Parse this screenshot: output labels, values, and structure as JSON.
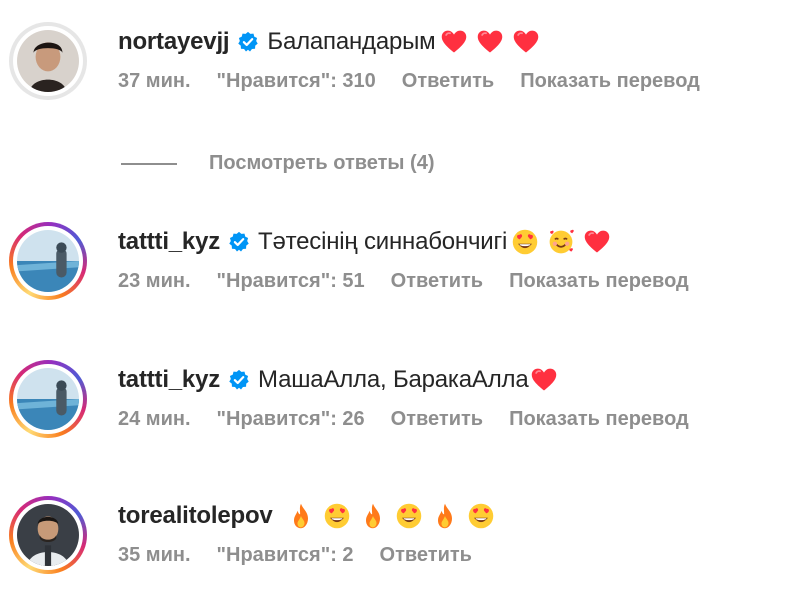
{
  "comments": [
    {
      "username": "nortayevjj",
      "text": "Балапандарым",
      "emojis": [
        "heart",
        "heart",
        "heart"
      ],
      "time": "37 мин.",
      "likes": "\"Нравится\": 310",
      "reply": "Ответить",
      "translate": "Показать перевод"
    },
    {
      "username": "tattti_kyz",
      "text": "Тәтесінің синнабончигі",
      "emojis": [
        "heart-eyes",
        "hearts-face",
        "heart"
      ],
      "time": "23 мин.",
      "likes": "\"Нравится\": 51",
      "reply": "Ответить",
      "translate": "Показать перевод"
    },
    {
      "username": "tattti_kyz",
      "text": "МашаАлла, БаракаАлла",
      "emojis": [
        "heart"
      ],
      "time": "24 мин.",
      "likes": "\"Нравится\": 26",
      "reply": "Ответить",
      "translate": "Показать перевод"
    },
    {
      "username": "torealitolepov",
      "text": "",
      "emojis": [
        "fire",
        "heart-eyes",
        "fire",
        "heart-eyes",
        "fire",
        "heart-eyes"
      ],
      "time": "35 мин.",
      "likes": "\"Нравится\": 2",
      "reply": "Ответить",
      "translate": ""
    }
  ],
  "view_replies": "Посмотреть ответы (4)",
  "colors": {
    "text": "#262626",
    "muted": "#8e8e8e",
    "verified": "#0095f6",
    "heart": "#ff3040"
  }
}
